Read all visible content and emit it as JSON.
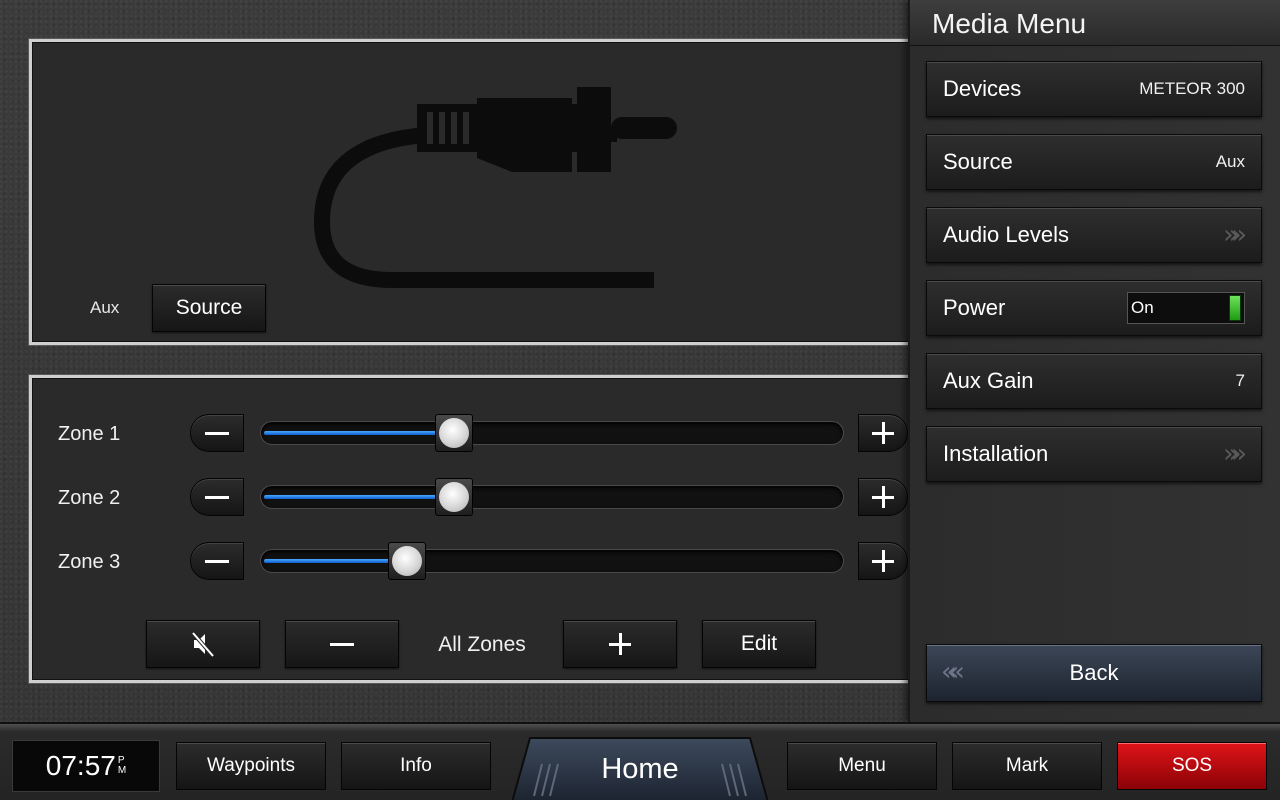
{
  "source_panel": {
    "source_name": "Aux",
    "source_button_label": "Source",
    "source_icon": "aux-plug-icon"
  },
  "zones": [
    {
      "label": "Zone 1",
      "level": 0.33
    },
    {
      "label": "Zone 2",
      "level": 0.33
    },
    {
      "label": "Zone 3",
      "level": 0.25
    }
  ],
  "all_zones": {
    "mute_icon": "mute-speaker-icon",
    "label": "All Zones",
    "edit_label": "Edit"
  },
  "media_menu": {
    "title": "Media Menu",
    "items": [
      {
        "label": "Devices",
        "value": "METEOR 300"
      },
      {
        "label": "Source",
        "value": "Aux"
      },
      {
        "label": "Audio Levels",
        "value": ""
      },
      {
        "label": "Power",
        "value": "On",
        "toggle_on": true
      },
      {
        "label": "Aux Gain",
        "value": "7"
      },
      {
        "label": "Installation",
        "value": ""
      }
    ],
    "back_label": "Back"
  },
  "bottom_bar": {
    "clock_time": "07:57",
    "clock_ampm_top": "P",
    "clock_ampm_bottom": "M",
    "waypoints_label": "Waypoints",
    "info_label": "Info",
    "home_label": "Home",
    "menu_label": "Menu",
    "mark_label": "Mark",
    "sos_label": "SOS"
  },
  "colors": {
    "slider_fill": "#2a8cf0",
    "sos_red": "#d4111a",
    "power_led": "#3cc52a"
  }
}
